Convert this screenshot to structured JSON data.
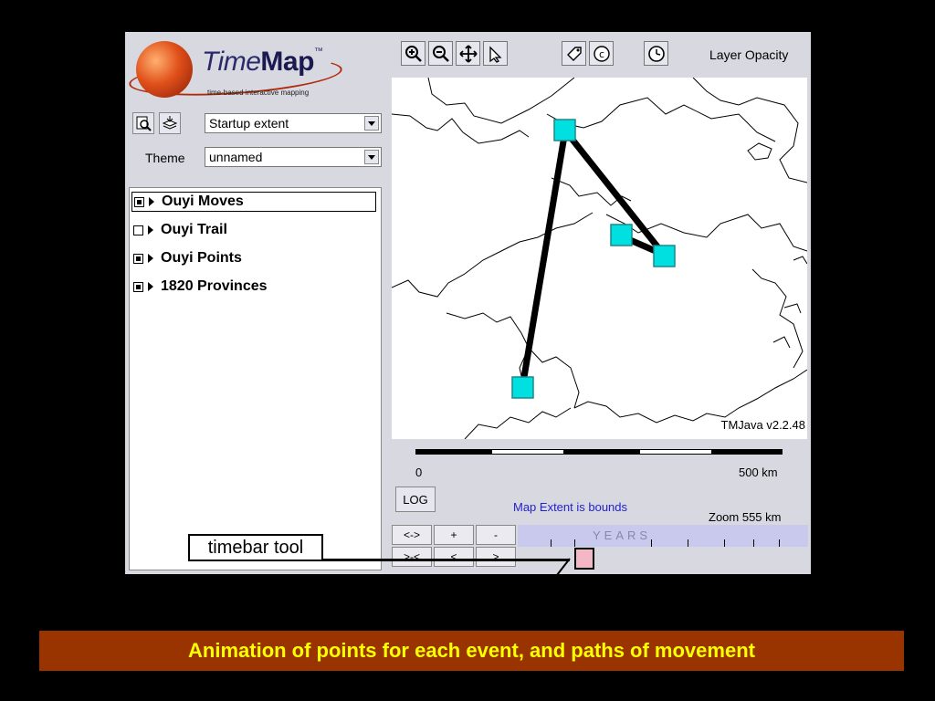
{
  "app": {
    "logo": {
      "title_a": "Time",
      "title_b": "Map",
      "tm": "™",
      "subtitle": "time-based interactive mapping"
    },
    "left_toolbar": {
      "extent_select": "Startup extent",
      "theme_label": "Theme",
      "theme_select": "unnamed"
    },
    "layers": [
      {
        "label": "Ouyi Moves",
        "checked": true,
        "selected": true
      },
      {
        "label": "Ouyi Trail",
        "checked": false,
        "selected": false
      },
      {
        "label": "Ouyi Points",
        "checked": true,
        "selected": false
      },
      {
        "label": "1820 Provinces",
        "checked": true,
        "selected": false
      }
    ],
    "map_toolbar": {
      "tools": [
        "zoom-in-icon",
        "zoom-out-icon",
        "pan-icon",
        "select-arrow-icon",
        "tag-icon",
        "copyright-icon",
        "clock-icon"
      ],
      "layer_opacity_label": "Layer Opacity"
    },
    "map": {
      "version": "TMJava v2.2.48",
      "scale_start": "0",
      "scale_end": "500 km"
    },
    "log_button": "LOG",
    "extent_status": "Map Extent is bounds",
    "zoom_status": "Zoom  555 km",
    "timebar": {
      "buttons_row1": [
        "<->",
        "+",
        "-"
      ],
      "buttons_row2": [
        ">-<",
        "<",
        ">"
      ],
      "years_label": "YEARS"
    }
  },
  "callout_label": "timebar tool",
  "caption": "Animation of points for each event, and paths of movement",
  "colors": {
    "caption_bg": "#993300",
    "caption_text": "#ffff00",
    "point_fill": "#00e0e0",
    "link_text": "#2222cc"
  }
}
